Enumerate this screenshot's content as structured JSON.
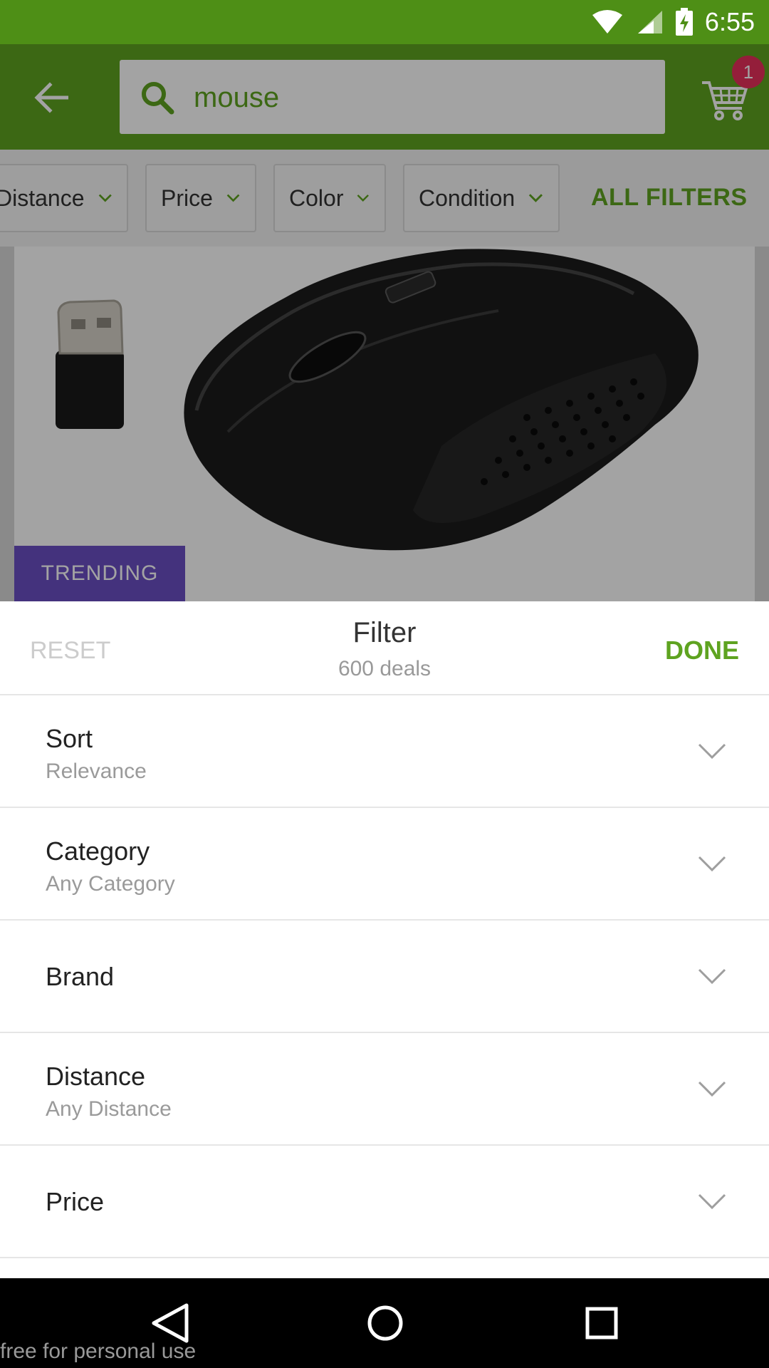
{
  "status_bar": {
    "time": "6:55"
  },
  "toolbar": {
    "search_value": "mouse",
    "cart_count": "1"
  },
  "chips": [
    {
      "label": "Distance"
    },
    {
      "label": "Price"
    },
    {
      "label": "Color"
    },
    {
      "label": "Condition"
    }
  ],
  "all_filters_label": "ALL FILTERS",
  "product": {
    "badge": "TRENDING"
  },
  "filter": {
    "reset_label": "RESET",
    "title": "Filter",
    "count": "600 deals",
    "done_label": "DONE",
    "rows": [
      {
        "title": "Sort",
        "subtitle": "Relevance"
      },
      {
        "title": "Category",
        "subtitle": "Any Category"
      },
      {
        "title": "Brand",
        "subtitle": ""
      },
      {
        "title": "Distance",
        "subtitle": "Any Distance"
      },
      {
        "title": "Price",
        "subtitle": ""
      }
    ]
  },
  "watermark": "free for personal use",
  "colors": {
    "brand_green": "#5ea320",
    "status_green": "#4e8f16",
    "badge_red": "#e8305c",
    "trending_purple": "#6b4fc4"
  }
}
